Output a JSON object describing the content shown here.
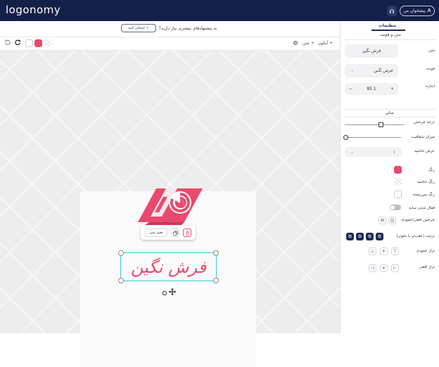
{
  "header": {
    "brand": "logonomy",
    "account_label": "پیشخوان من",
    "help_icon": "headset-icon",
    "user_icon": "user-icon"
  },
  "suggest": {
    "question": "به پیشنهادهای بیشتری نیاز دارید؟",
    "button_label": "امتحان کنید",
    "button_icon": "sparkle-icon"
  },
  "toolbar": {
    "add_icon_label": "آیکون",
    "add_text_label": "متن",
    "settings_icon": "gear-icon",
    "undo_icon": "undo-icon",
    "redo_icon": "redo-icon",
    "swatches": [
      "#ffffff",
      "#e84a6f",
      "transparent"
    ]
  },
  "canvas": {
    "logo_text": "فرش نگین",
    "context_menu": {
      "edit_text_label": "تغییر متن",
      "copy_icon": "copy-icon",
      "delete_icon": "trash-icon"
    },
    "rotate_icon": "rotate-icon",
    "move_icon": "move-icon",
    "brand_color": "#e84a6f"
  },
  "panel": {
    "title": "تنظیمات",
    "text_font_section": "متن و فونت",
    "text_label": "متن",
    "text_value": "فرش نگین",
    "font_label": "فونت",
    "font_value": "فرش نگین",
    "size_label": "اندازه",
    "size_value": "85.1",
    "size_minus": "−",
    "size_plus": "+",
    "other_section": "سایر",
    "rotation_label": "درجه چرخش",
    "opacity_label": "میزان شفافیت",
    "border_width_label": "عرض حاشیه",
    "border_width_value": "۱",
    "color_label": "رنگ",
    "color_value": "#e84a6f",
    "border_color_label": "رنگ حاشیه",
    "bg_color_label": "رنگ پس‌زمینه",
    "shadow_label": "فعال شدن سایه",
    "flip_label": "چرخش افقی/عمودی",
    "order_label": "ترتیب (عقب‌تر یا جلوتر)",
    "valign_label": "تراز عمودی",
    "halign_label": "تراز افقی"
  }
}
